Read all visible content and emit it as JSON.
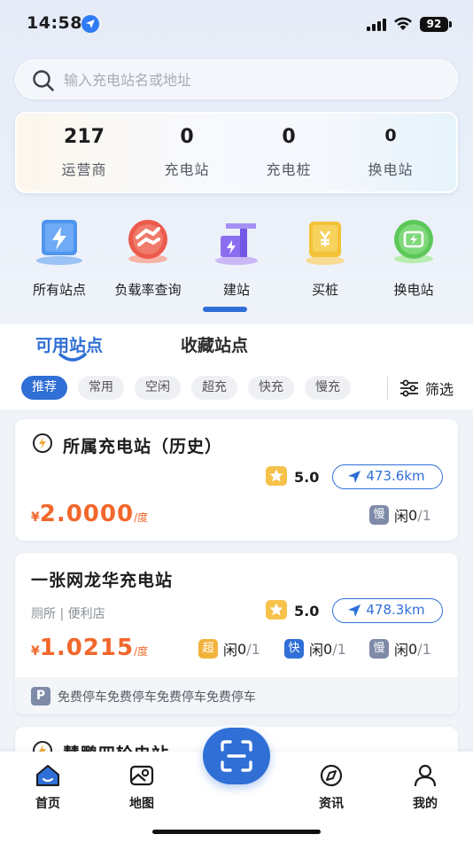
{
  "status_bar": {
    "time": "14:58",
    "battery": "92"
  },
  "search": {
    "placeholder": "输入充电站名或地址"
  },
  "stats": [
    {
      "value": "217",
      "label": "运营商"
    },
    {
      "value": "0",
      "label": "充电站"
    },
    {
      "value": "0",
      "label": "充电桩"
    },
    {
      "value": "0",
      "label": "换电站"
    }
  ],
  "quick_entries": [
    {
      "label": "所有站点",
      "icon": "all-stations-icon"
    },
    {
      "label": "负载率查询",
      "icon": "load-rate-icon"
    },
    {
      "label": "建站",
      "icon": "build-station-icon"
    },
    {
      "label": "买桩",
      "icon": "buy-pile-icon"
    },
    {
      "label": "换电站",
      "icon": "battery-swap-icon"
    }
  ],
  "tabs": [
    {
      "label": "可用站点",
      "active": true
    },
    {
      "label": "收藏站点",
      "active": false
    }
  ],
  "filters": {
    "chips": [
      "推荐",
      "常用",
      "空闲",
      "超充",
      "快充",
      "慢充"
    ],
    "active": "推荐",
    "filter_label": "筛选"
  },
  "stations": [
    {
      "name": "所属充电站（历史）",
      "rating": "5.0",
      "distance": "473.6km",
      "price_currency": "¥",
      "price": "2.0000",
      "price_unit": "/度",
      "counts": [
        {
          "type": "慢",
          "idle_label": "闲",
          "idle": "0",
          "total": "/1"
        }
      ]
    },
    {
      "name": "一张网龙华充电站",
      "tags": "厕所 | 便利店",
      "rating": "5.0",
      "distance": "478.3km",
      "price_currency": "¥",
      "price": "1.0215",
      "price_unit": "/度",
      "counts": [
        {
          "type": "超",
          "idle_label": "闲",
          "idle": "0",
          "total": "/1"
        },
        {
          "type": "快",
          "idle_label": "闲",
          "idle": "0",
          "total": "/1"
        },
        {
          "type": "慢",
          "idle_label": "闲",
          "idle": "0",
          "total": "/1"
        }
      ],
      "parking_badge": "P",
      "parking": "免费停车免费停车免费停车免费停车"
    },
    {
      "name": "慧鹏四轮电站"
    }
  ],
  "bottom_nav": [
    {
      "label": "首页",
      "icon": "home-icon",
      "active": true
    },
    {
      "label": "地图",
      "icon": "map-icon"
    },
    {
      "label": "资讯",
      "icon": "compass-icon"
    },
    {
      "label": "我的",
      "icon": "profile-icon"
    }
  ],
  "colors": {
    "accent": "#2f6fd6",
    "price": "#f2672b",
    "star": "#f6c24a"
  }
}
